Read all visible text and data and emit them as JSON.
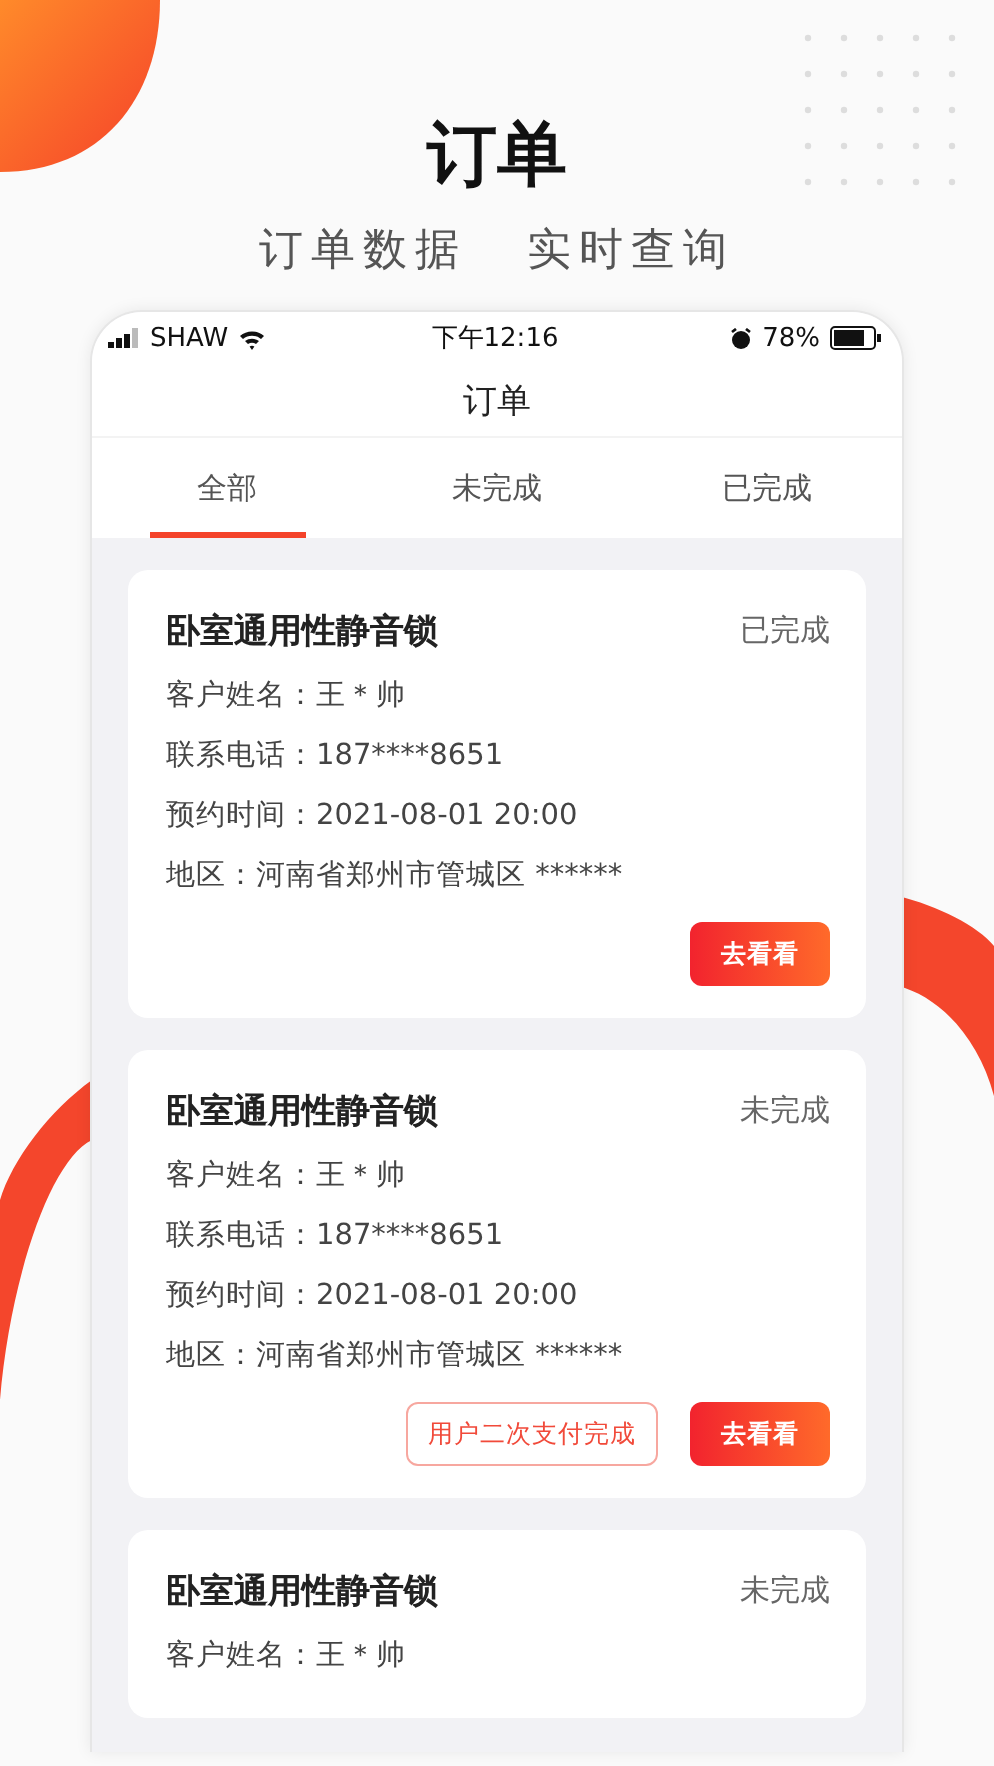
{
  "header": {
    "title": "订单",
    "subtitle": [
      "订单数据",
      "实时查询"
    ]
  },
  "status_bar": {
    "carrier": "SHAW",
    "time": "下午12:16",
    "battery": "78%"
  },
  "nav_title": "订单",
  "tabs": [
    {
      "label": "全部",
      "selected": true
    },
    {
      "label": "未完成",
      "selected": false
    },
    {
      "label": "已完成",
      "selected": false
    }
  ],
  "orders": [
    {
      "product": "卧室通用性静音锁",
      "status": "已完成",
      "fields": [
        "客户姓名：王＊帅",
        "联系电话：187****8651",
        "预约时间：2021-08-01 20:00",
        "地区：河南省郑州市管城区 ******"
      ],
      "buttons": [
        {
          "label": "去看看",
          "kind": "primary"
        }
      ]
    },
    {
      "product": "卧室通用性静音锁",
      "status": "未完成",
      "fields": [
        "客户姓名：王＊帅",
        "联系电话：187****8651",
        "预约时间：2021-08-01 20:00",
        "地区：河南省郑州市管城区 ******"
      ],
      "buttons": [
        {
          "label": "用户二次支付完成",
          "kind": "outline"
        },
        {
          "label": "去看看",
          "kind": "primary"
        }
      ]
    },
    {
      "product": "卧室通用性静音锁",
      "status": "未完成",
      "fields": [
        "客户姓名：王＊帅"
      ]
    }
  ]
}
